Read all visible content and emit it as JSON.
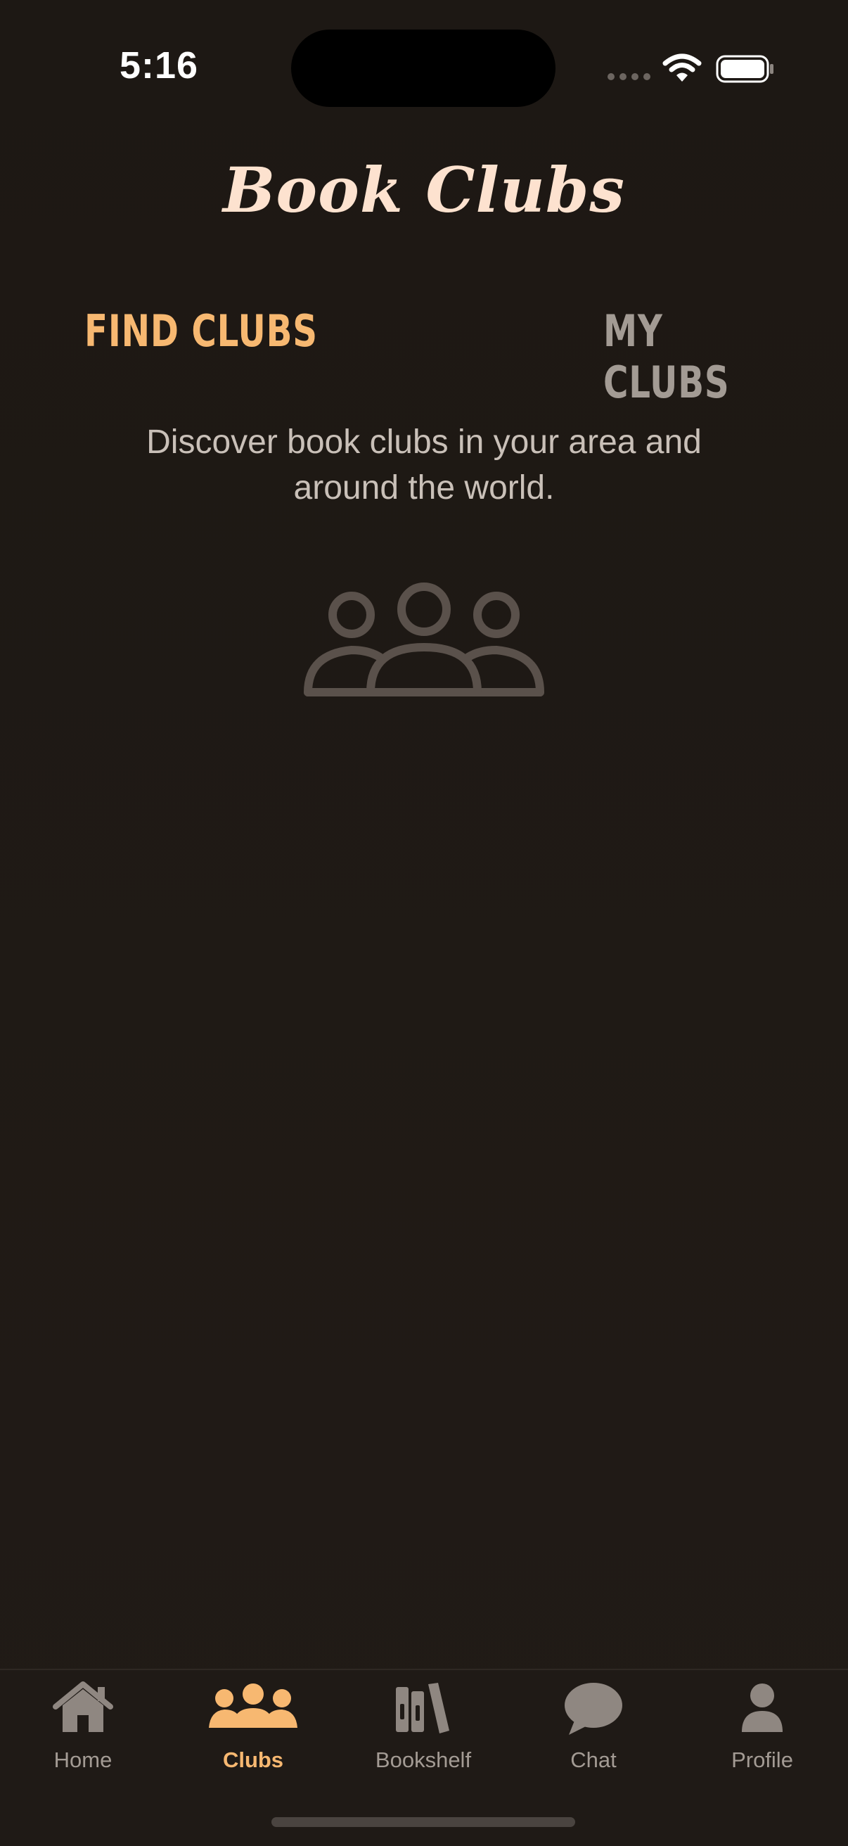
{
  "status_bar": {
    "time": "5:16",
    "icons": [
      "cellular-dots-icon",
      "wifi-icon",
      "battery-icon"
    ]
  },
  "header": {
    "title": "Book Clubs"
  },
  "tabs": [
    {
      "label": "FIND CLUBS",
      "active": true
    },
    {
      "label": "MY CLUBS",
      "active": false
    }
  ],
  "content": {
    "intro": "Discover book clubs in your area and around the world.",
    "illustration_icon": "people-group-icon"
  },
  "tab_bar": {
    "items": [
      {
        "label": "Home",
        "icon": "home-icon",
        "active": false
      },
      {
        "label": "Clubs",
        "icon": "people-group-icon",
        "active": true
      },
      {
        "label": "Bookshelf",
        "icon": "books-icon",
        "active": false
      },
      {
        "label": "Chat",
        "icon": "chat-bubble-icon",
        "active": false
      },
      {
        "label": "Profile",
        "icon": "person-icon",
        "active": false
      }
    ]
  },
  "colors": {
    "background": "#1f1a16",
    "accent": "#f7b871",
    "title": "#fde2cf",
    "inactive": "#a39b94",
    "illustration": "#5a514b"
  }
}
